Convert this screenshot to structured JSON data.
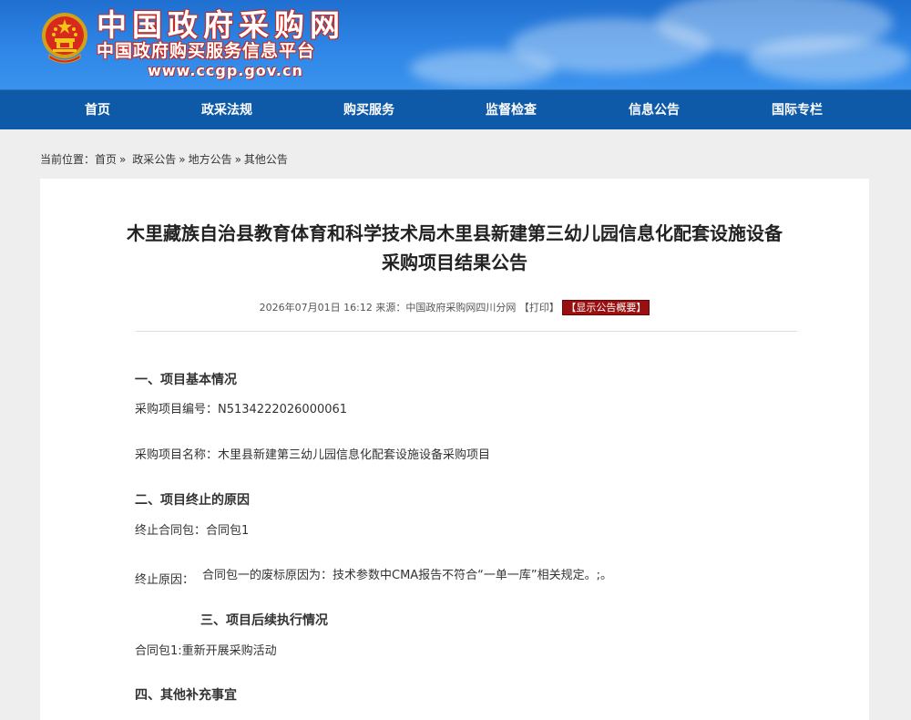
{
  "header": {
    "site_title": "中国政府采购网",
    "site_subtitle": "中国政府购买服务信息平台",
    "site_url": "www.ccgp.gov.cn"
  },
  "nav": {
    "items": [
      "首页",
      "政采法规",
      "购买服务",
      "监督检查",
      "信息公告",
      "国际专栏"
    ]
  },
  "breadcrumb": {
    "label": "当前位置：",
    "items": [
      "首页",
      "政采公告",
      "地方公告",
      "其他公告"
    ],
    "separator": "»"
  },
  "article": {
    "title_line1": "木里藏族自治县教育体育和科学技术局木里县新建第三幼儿园信息化配套设施设备",
    "title_line2": "采购项目结果公告",
    "meta": {
      "date": "2026年07月01日 16:12",
      "source_label": "来源：",
      "source": "中国政府采购网四川分网",
      "print": "【打印】",
      "summary_button": "【显示公告概要】"
    },
    "sections": {
      "s1_heading": "一、项目基本情况",
      "project_no": "采购项目编号：N5134222026000061",
      "project_name": "采购项目名称：木里县新建第三幼儿园信息化配套设施设备采购项目",
      "s2_heading": "二、项目终止的原因",
      "terminated_pkg": "终止合同包：合同包1",
      "reason_label": "终止原因：",
      "reason_text": "合同包一的废标原因为：技术参数中CMA报告不符合“一单一库”相关规定。;。",
      "s3_heading": "三、项目后续执行情况",
      "followup": "合同包1:重新开展采购活动",
      "s4_heading": "四、其他补充事宜"
    }
  },
  "colors": {
    "nav_bg": "#0e5aa8",
    "header_blue": "#2f86e6",
    "title_outline": "#c8281e",
    "summary_btn_bg": "#9a1010"
  }
}
